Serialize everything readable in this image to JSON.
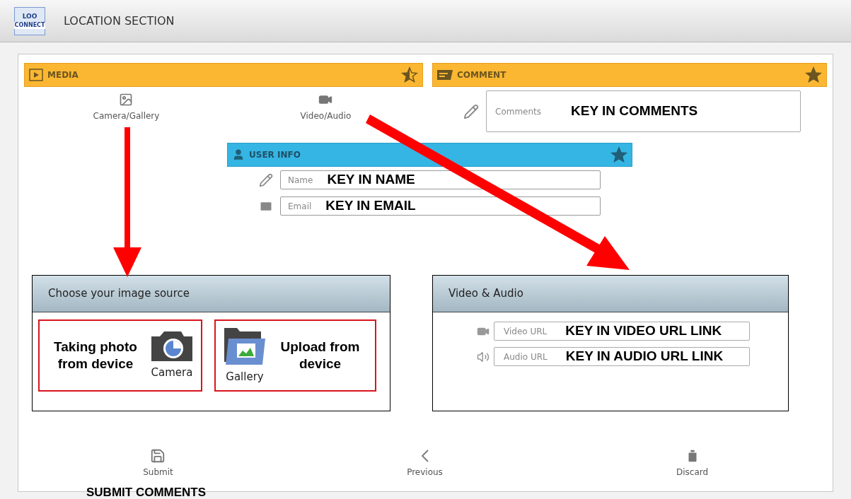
{
  "header": {
    "logo": [
      "LOO",
      "CONNECT"
    ],
    "title": "LOCATION SECTION"
  },
  "media": {
    "title": "MEDIA",
    "starred": true,
    "star_half": true,
    "items": [
      {
        "kind": "image",
        "label": "Camera/Gallery"
      },
      {
        "kind": "video",
        "label": "Video/Audio"
      }
    ]
  },
  "comment": {
    "title": "COMMENT",
    "starred": true,
    "star_half": false,
    "field": {
      "label": "Comments",
      "annotation": "KEY IN COMMENTS"
    }
  },
  "user_info": {
    "title": "USER INFO",
    "starred": true,
    "star_half": false,
    "fields": [
      {
        "kind": "name",
        "label": "Name",
        "annotation": "KEY IN NAME"
      },
      {
        "kind": "email",
        "label": "Email",
        "annotation": "KEY IN EMAIL"
      }
    ]
  },
  "image_source_dialog": {
    "title": "Choose your image source",
    "options": [
      {
        "kind": "camera",
        "label": "Camera",
        "annotation": "Taking photo from device"
      },
      {
        "kind": "gallery",
        "label": "Gallery",
        "annotation": "Upload from device"
      }
    ]
  },
  "video_audio_dialog": {
    "title": "Video & Audio",
    "fields": [
      {
        "kind": "video",
        "label": "Video URL",
        "annotation": "KEY IN VIDEO URL LINK"
      },
      {
        "kind": "audio",
        "label": "Audio URL",
        "annotation": "KEY IN AUDIO URL LINK"
      }
    ]
  },
  "bottom_bar": [
    {
      "kind": "submit",
      "label": "Submit"
    },
    {
      "kind": "previous",
      "label": "Previous"
    },
    {
      "kind": "discard",
      "label": "Discard"
    }
  ],
  "annotations": {
    "submit_note": "SUBMIT COMMENTS"
  }
}
